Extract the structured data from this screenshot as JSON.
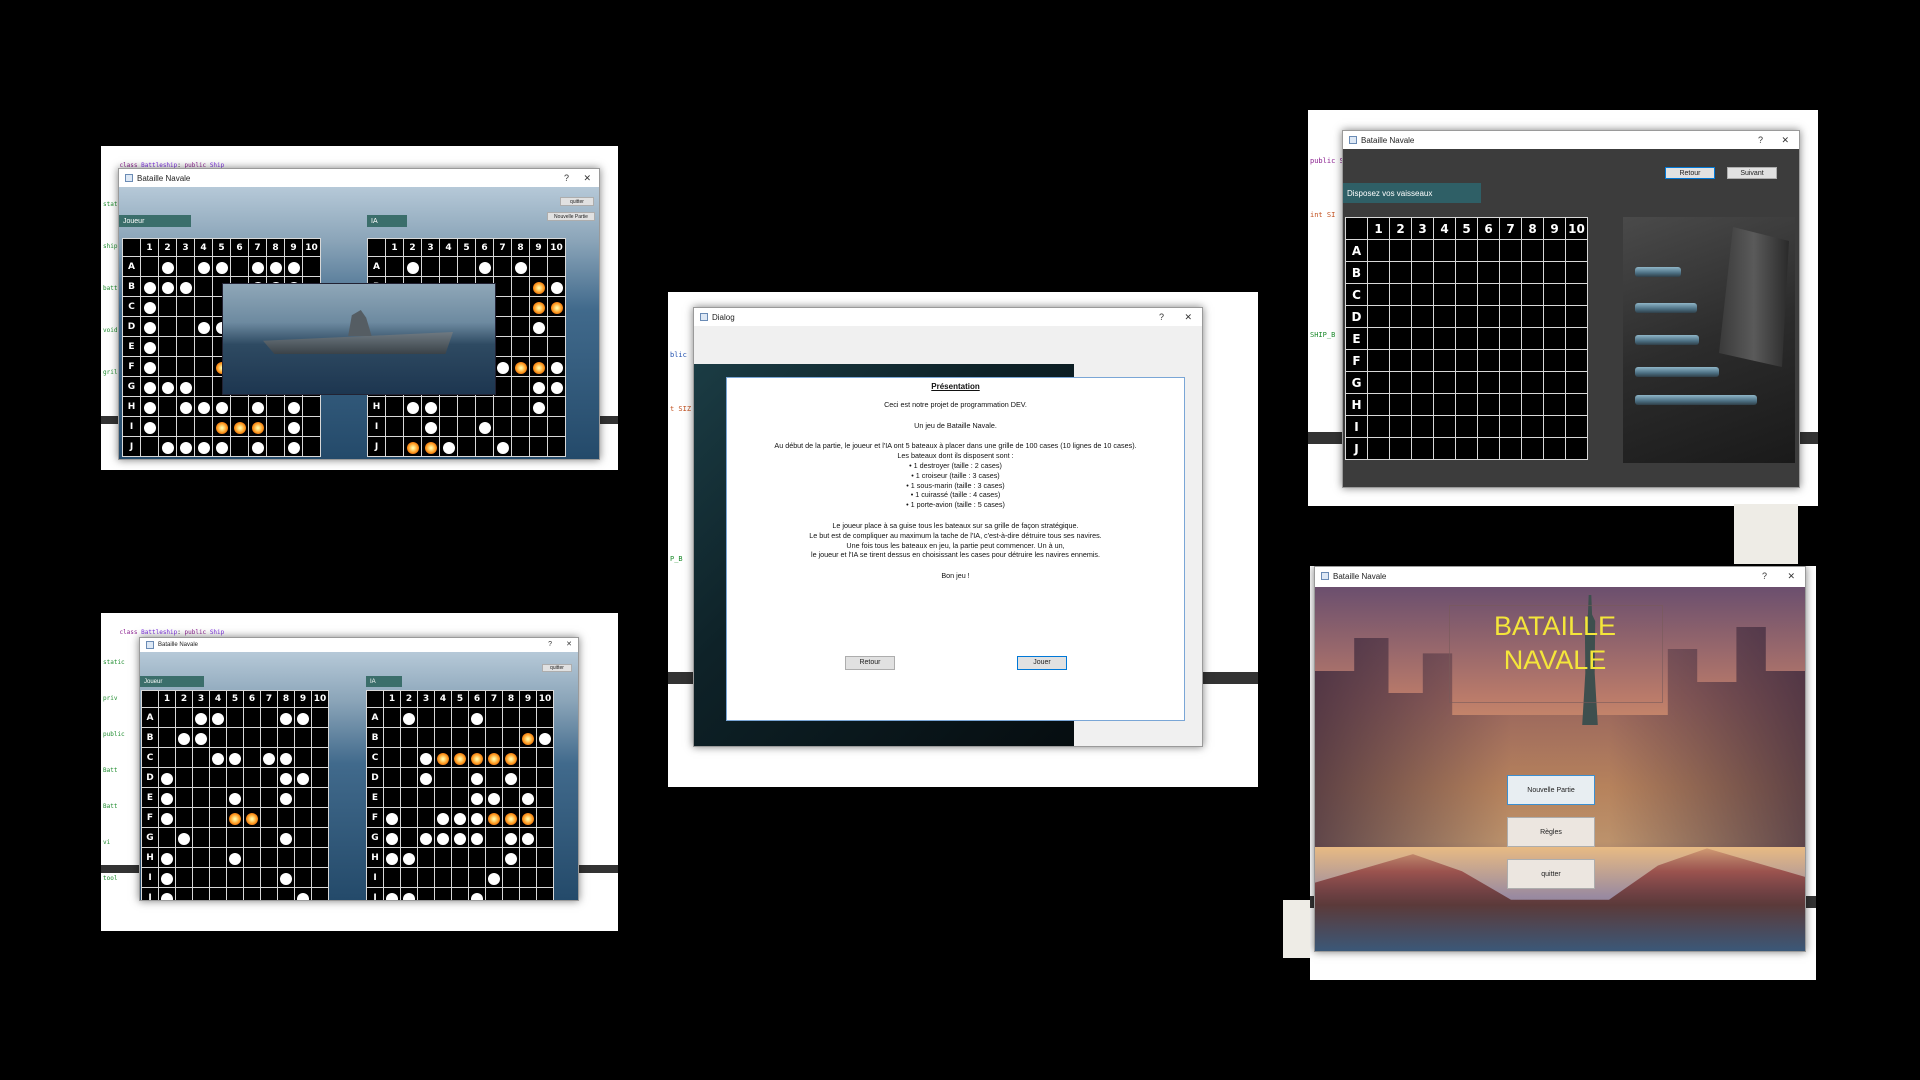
{
  "common": {
    "window_title": "Bataille Navale",
    "help": "?",
    "close": "✕",
    "cols": [
      "1",
      "2",
      "3",
      "4",
      "5",
      "6",
      "7",
      "8",
      "9",
      "10"
    ],
    "rows": [
      "A",
      "B",
      "C",
      "D",
      "E",
      "F",
      "G",
      "H",
      "I",
      "J"
    ]
  },
  "shot1": {
    "code_top": "Battleship",
    "code_kw": "public",
    "code_cls": "Ship",
    "left_margin": [
      "stat",
      "ship",
      "batt",
      "void",
      "grille"
    ],
    "quit": "quitter",
    "new_game": "Nouvelle Partie",
    "player_label": "Joueur",
    "ai_label": "IA"
  },
  "shot2": {
    "code_top": "Battleship",
    "code_kw": "public",
    "code_cls": "Ship",
    "left_margin": [
      "static",
      "priv",
      "public",
      "Batt",
      "Batt",
      "vi",
      "tool"
    ],
    "quit": "quitter",
    "player_label": "Joueur",
    "ai_label": "IA"
  },
  "shot3": {
    "window_title": "Dialog",
    "code_lines": [
      "blic",
      "t SIZ",
      "P_B"
    ],
    "heading": "Présentation",
    "p1": "Ceci est notre projet de programmation DEV.",
    "p2": "Un jeu de Bataille Navale.",
    "p3": "Au début de la partie, le joueur et l'IA ont  5 bateaux à placer dans une grille de 100 cases (10 lignes de 10 cases).",
    "p3b": "Les bateaux dont ils disposent sont :",
    "items": [
      "• 1 destroyer (taille : 2 cases)",
      "• 1 croiseur (taille : 3 cases)",
      "• 1 sous-marin (taille : 3 cases)",
      "• 1 cuirassé (taille : 4 cases)",
      "• 1 porte-avion (taille : 5 cases)"
    ],
    "p4": [
      "Le joueur place à sa guise tous les bateaux sur sa grille de façon stratégique.",
      "Le but est de compliquer au maximum la tache de l'IA, c'est-à-dire détruire tous ses navires.",
      "Une fois tous les bateaux en jeu, la partie peut commencer. Un à un,",
      "le joueur et l'IA se tirent dessus en choisissant les cases pour détruire les navires ennemis."
    ],
    "p5": "Bon jeu !",
    "back": "Retour",
    "play": "Jouer"
  },
  "shot4": {
    "code_lines": [
      "public Ship",
      "int SI",
      "SHIP_B"
    ],
    "back": "Retour",
    "next": "Suivant",
    "place_label": "Disposez vos vaisseaux"
  },
  "shot5": {
    "title_line1": "BATAILLE",
    "title_line2": "NAVALE",
    "new_game": "Nouvelle Partie",
    "rules": "Règles",
    "quit": "quitter"
  },
  "colors": {
    "background": "#000000",
    "title_yellow": "#f4e63a",
    "header_teal": "#3b6e6b",
    "hit_orange": "#ff9a20"
  }
}
